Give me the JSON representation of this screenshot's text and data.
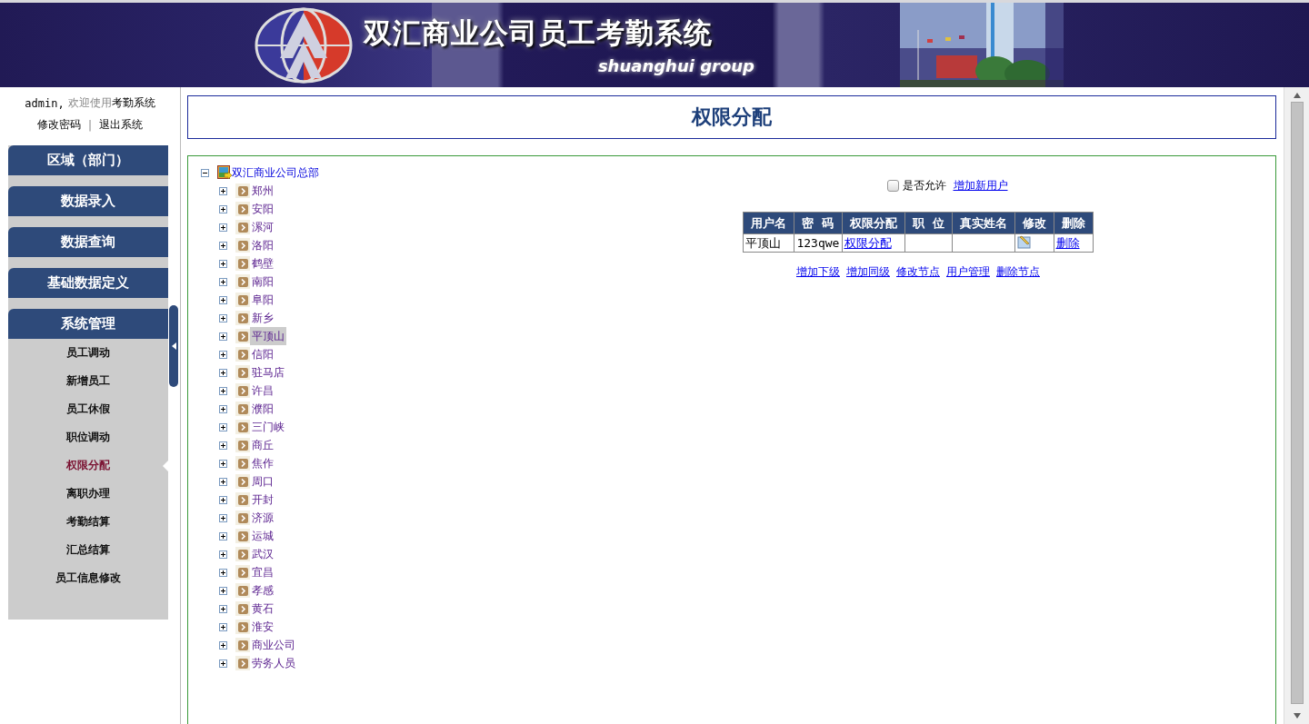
{
  "header": {
    "title": "双汇商业公司员工考勤系统",
    "subtitle": "shuanghui group"
  },
  "user_bar": {
    "user": "admin,",
    "welcome": "欢迎使用",
    "system": "考勤系统",
    "links": [
      "修改密码",
      "退出系统"
    ],
    "separator": "|"
  },
  "menu": [
    {
      "label": "区域（部门）"
    },
    {
      "label": "数据录入"
    },
    {
      "label": "数据查询"
    },
    {
      "label": "基础数据定义"
    },
    {
      "label": "系统管理",
      "items": [
        {
          "label": "员工调动",
          "selected": false
        },
        {
          "label": "新增员工",
          "selected": false
        },
        {
          "label": "员工休假",
          "selected": false
        },
        {
          "label": "职位调动",
          "selected": false
        },
        {
          "label": "权限分配",
          "selected": true
        },
        {
          "label": "离职办理",
          "selected": false
        },
        {
          "label": "考勤结算",
          "selected": false
        },
        {
          "label": "汇总结算",
          "selected": false
        },
        {
          "label": "员工信息修改",
          "selected": false
        }
      ]
    }
  ],
  "page_title": "权限分配",
  "tree": {
    "label": "双汇商业公司总部",
    "expanded": true,
    "children": [
      {
        "label": "郑州",
        "selected": false
      },
      {
        "label": "安阳",
        "selected": false
      },
      {
        "label": "漯河",
        "selected": false
      },
      {
        "label": "洛阳",
        "selected": false
      },
      {
        "label": "鹤壁",
        "selected": false
      },
      {
        "label": "南阳",
        "selected": false
      },
      {
        "label": "阜阳",
        "selected": false
      },
      {
        "label": "新乡",
        "selected": false
      },
      {
        "label": "平顶山",
        "selected": true
      },
      {
        "label": "信阳",
        "selected": false
      },
      {
        "label": "驻马店",
        "selected": false
      },
      {
        "label": "许昌",
        "selected": false
      },
      {
        "label": "濮阳",
        "selected": false
      },
      {
        "label": "三门峡",
        "selected": false
      },
      {
        "label": "商丘",
        "selected": false
      },
      {
        "label": "焦作",
        "selected": false
      },
      {
        "label": "周口",
        "selected": false
      },
      {
        "label": "开封",
        "selected": false
      },
      {
        "label": "济源",
        "selected": false
      },
      {
        "label": "运城",
        "selected": false
      },
      {
        "label": "武汉",
        "selected": false
      },
      {
        "label": "宜昌",
        "selected": false
      },
      {
        "label": "孝感",
        "selected": false
      },
      {
        "label": "黄石",
        "selected": false
      },
      {
        "label": "淮安",
        "selected": false
      },
      {
        "label": "商业公司",
        "selected": false
      },
      {
        "label": "劳务人员",
        "selected": false
      }
    ]
  },
  "allow": {
    "label": "是否允许",
    "checked": false
  },
  "add_user_link": "增加新用户",
  "users_table": {
    "columns": [
      "用户名",
      "密  码",
      "权限分配",
      "职  位",
      "真实姓名",
      "修改",
      "删除"
    ],
    "rows": [
      {
        "username": "平顶山",
        "password": "123qwe",
        "permission_link": "权限分配",
        "delete_link": "删除"
      }
    ]
  },
  "actions": [
    "增加下级",
    "增加同级",
    "修改节点",
    "用户管理",
    "删除节点"
  ]
}
